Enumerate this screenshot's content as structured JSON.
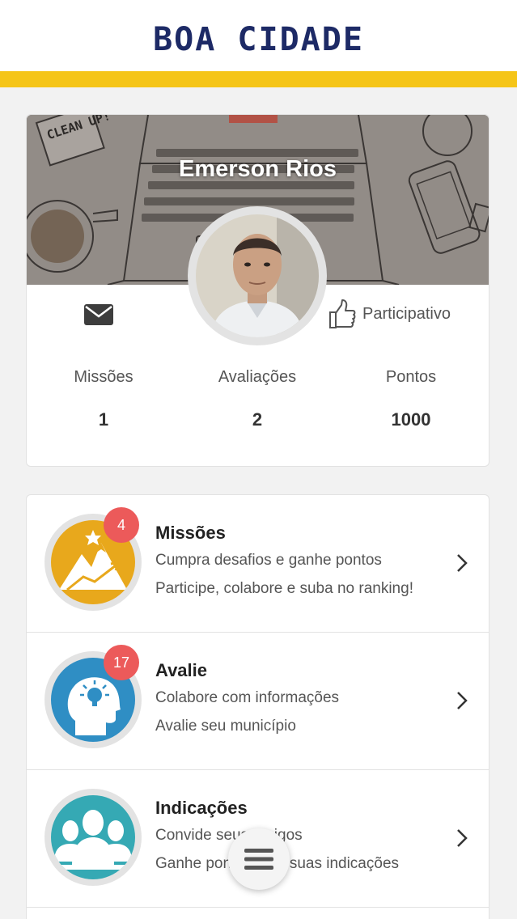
{
  "header": {
    "logo_text": "BOA CIDADE",
    "accent_color": "#f5c518",
    "logo_color": "#1d2a66"
  },
  "profile": {
    "name": "Emerson Rios",
    "cover_sticker": "CLEAN UP!",
    "avatar_icon": "user-photo",
    "message_icon": "envelope-icon",
    "rank_icon": "thumbs-up-icon",
    "rank_label": "Participativo",
    "stats": [
      {
        "label": "Missões",
        "value": "1"
      },
      {
        "label": "Avaliações",
        "value": "2"
      },
      {
        "label": "Pontos",
        "value": "1000"
      }
    ]
  },
  "menu": {
    "items": [
      {
        "title": "Missões",
        "line1": "Cumpra desafios e ganhe pontos",
        "line2": "Participe, colabore e suba no ranking!",
        "badge": "4",
        "icon": "mountain-icon",
        "color": "#e8a81c"
      },
      {
        "title": "Avalie",
        "line1": "Colabore com informações",
        "line2": "Avalie seu município",
        "badge": "17",
        "icon": "head-idea-icon",
        "color": "#2f8ec4"
      },
      {
        "title": "Indicações",
        "line1": "Convide seus amigos",
        "line2": "Ganhe pontos com suas indicações",
        "icon": "people-icon",
        "color": "#35a9b4"
      }
    ]
  },
  "fab": {
    "icon": "hamburger-menu-icon"
  },
  "badge_color": "#ec5a5a"
}
